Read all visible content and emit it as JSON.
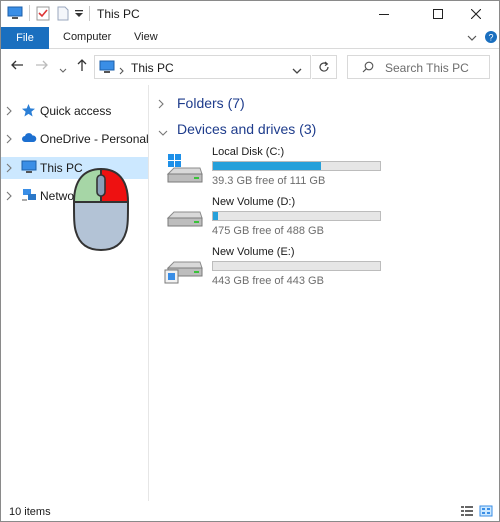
{
  "window": {
    "title": "This PC"
  },
  "ribbon": {
    "tabs": [
      "File",
      "Computer",
      "View"
    ]
  },
  "address": {
    "location": "This PC"
  },
  "search": {
    "placeholder": "Search This PC"
  },
  "navigation": {
    "items": [
      {
        "label": "Quick access",
        "icon": "star-icon"
      },
      {
        "label": "OneDrive - Personal",
        "icon": "cloud-icon"
      },
      {
        "label": "This PC",
        "icon": "computer-icon"
      },
      {
        "label": "Network",
        "icon": "network-icon"
      }
    ]
  },
  "content": {
    "folders_header": "Folders (7)",
    "devices_header": "Devices and drives (3)",
    "drives": [
      {
        "name": "Local Disk (C:)",
        "free_text": "39.3 GB free of 111 GB",
        "used_fraction": 0.646,
        "icon": "windows-drive-icon"
      },
      {
        "name": "New Volume (D:)",
        "free_text": "475 GB free of 488 GB",
        "used_fraction": 0.027,
        "icon": "hard-drive-icon"
      },
      {
        "name": "New Volume (E:)",
        "free_text": "443 GB free of 443 GB",
        "used_fraction": 0.0,
        "icon": "removable-drive-icon"
      }
    ]
  },
  "status": {
    "items_count": "10 items"
  },
  "colors": {
    "accent": "#1a6fbf",
    "selection": "#cce8ff",
    "bar_fill": "#26a0da",
    "group_header": "#1e3c8c",
    "mouse_left_button": "#a6d6a6",
    "mouse_right_button": "#ee1111",
    "mouse_body": "#b3c3d6"
  }
}
